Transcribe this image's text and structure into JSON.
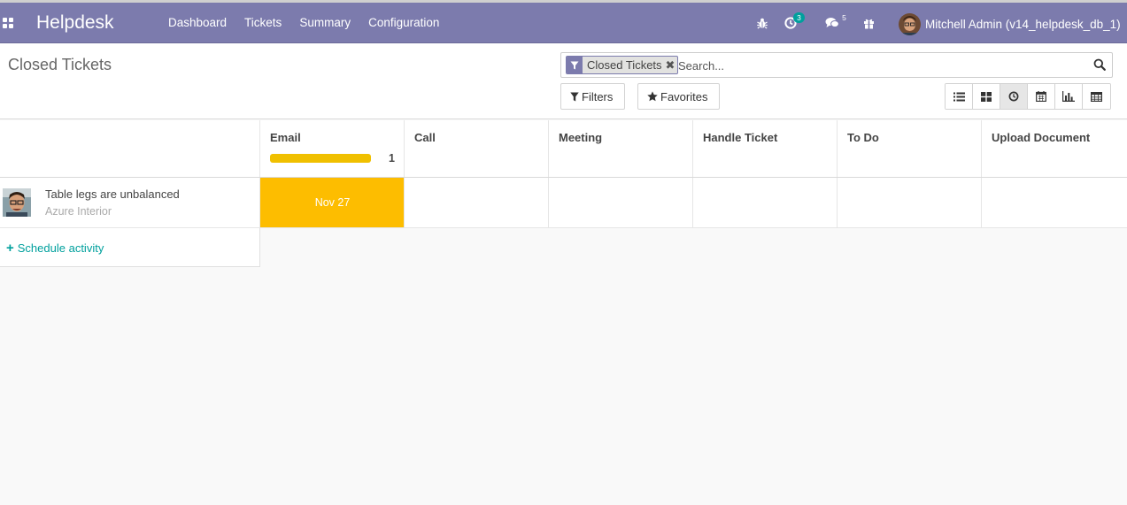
{
  "navbar": {
    "brand": "Helpdesk",
    "menu": [
      "Dashboard",
      "Tickets",
      "Summary",
      "Configuration"
    ],
    "activity_count": "3",
    "message_count": "5",
    "user_name": "Mitchell Admin (v14_helpdesk_db_1)",
    "icons": [
      "apps-grid-icon",
      "bug-icon",
      "clock-icon",
      "chat-icon",
      "gift-icon"
    ]
  },
  "control_panel": {
    "title": "Closed Tickets",
    "facet_label": "Closed Tickets",
    "facet_close": "✖",
    "search_placeholder": "Search...",
    "filters_label": "Filters",
    "favorites_label": "Favorites",
    "views": [
      "list-view-icon",
      "kanban-view-icon",
      "activity-view-icon",
      "calendar-view-icon",
      "graph-view-icon",
      "pivot-view-icon"
    ],
    "active_view": "activity-view-icon"
  },
  "grid": {
    "columns": [
      {
        "title": "Email",
        "count": "1",
        "progress": 1.0
      },
      {
        "title": "Call"
      },
      {
        "title": "Meeting"
      },
      {
        "title": "Handle Ticket"
      },
      {
        "title": "To Do"
      },
      {
        "title": "Upload Document"
      }
    ],
    "records": [
      {
        "name": "Table legs are unbalanced",
        "partner": "Azure Interior",
        "email_deadline": "Nov 27"
      }
    ],
    "schedule_label": "Schedule activity",
    "schedule_plus": "+"
  },
  "colors": {
    "navbar": "#7c7bad",
    "deadline": "#fdbd00",
    "progress": "#f0c000",
    "link": "#00a09d",
    "badge_activity": "#00a09d"
  }
}
